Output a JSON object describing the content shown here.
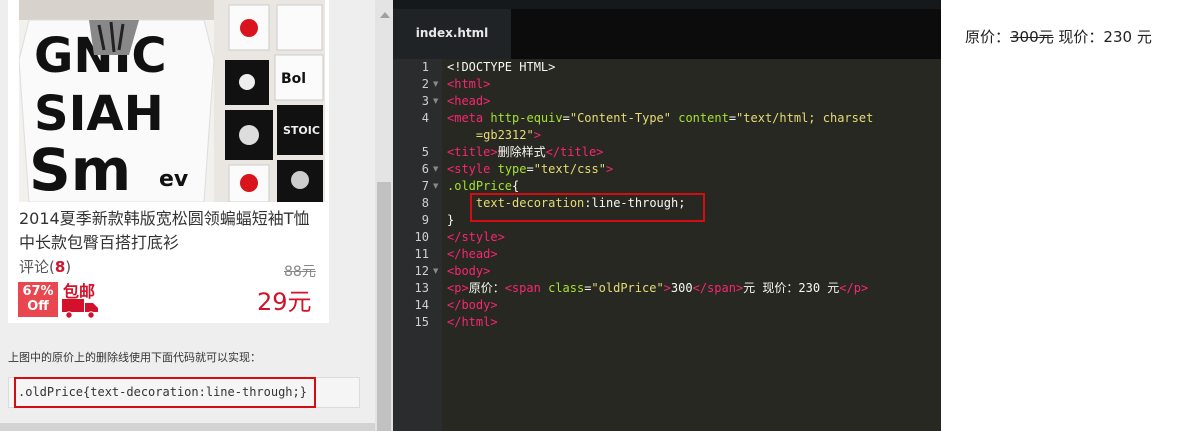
{
  "product": {
    "title": "2014夏季新款韩版宽松圆领蝙蝠短袖T恤中长款包臀百搭打底衫",
    "comments_label": "评论(",
    "comments_count": "8",
    "comments_close": ")",
    "old_price": "88元",
    "discount_line1": "67%",
    "discount_line2": "Off",
    "free_shipping": "包邮",
    "new_price": "29元",
    "photo_text": [
      "GNIC",
      "SIAH",
      "Sm",
      "ev",
      "Bol",
      "STOIC"
    ]
  },
  "lesson": {
    "explain": "上图中的原价上的删除线使用下面代码就可以实现：",
    "snippet": ".oldPrice{text-decoration:line-through;}"
  },
  "editor": {
    "tab": "index.html",
    "line_numbers": [
      "1",
      "2",
      "3",
      "4",
      "",
      "5",
      "6",
      "7",
      "8",
      "9",
      "10",
      "11",
      "12",
      "13",
      "14",
      "15"
    ],
    "lines": [
      {
        "doctype": "<!DOCTYPE HTML>"
      },
      {
        "tag": "<html>"
      },
      {
        "tag": "<head>"
      },
      {
        "open": "<meta",
        "a1": "http-equiv",
        "eq1": "=",
        "s1": "\"Content-Type\"",
        "a2": "content",
        "eq2": "=",
        "s2": "\"text/html; charset"
      },
      {
        "s": "=gb2312\"",
        "close": ">"
      },
      {
        "open": "<title>",
        "text": "删除样式",
        "close": "</title>"
      },
      {
        "open": "<style",
        "a1": "type",
        "eq1": "=",
        "s1": "\"text/css\"",
        "close": ">"
      },
      {
        "sel": ".oldPrice",
        "brace": "{"
      },
      {
        "prop": "text-decoration",
        "colon": ":",
        "val": "line-through;"
      },
      {
        "brace": "}"
      },
      {
        "tag": "</style>"
      },
      {
        "tag": "</head>"
      },
      {
        "tag": "<body>"
      },
      {
        "open": "<p>",
        "t1": "原价：",
        "span_open": "<span",
        "a1": "class",
        "eq1": "=",
        "s1": "\"oldPrice\"",
        "gt": ">",
        "num": "300",
        "span_close": "</span>",
        "t2": "元 现价：230 元",
        "close": "</p>"
      },
      {
        "tag": "</body>"
      },
      {
        "tag": "</html>"
      }
    ]
  },
  "preview": {
    "label_old": "原价：",
    "old_price": "300元",
    "rest": " 现价：230 元"
  },
  "colors": {
    "highlight_border": "#d40d12",
    "price_red": "#d4112b",
    "editor_bg": "#272822"
  }
}
